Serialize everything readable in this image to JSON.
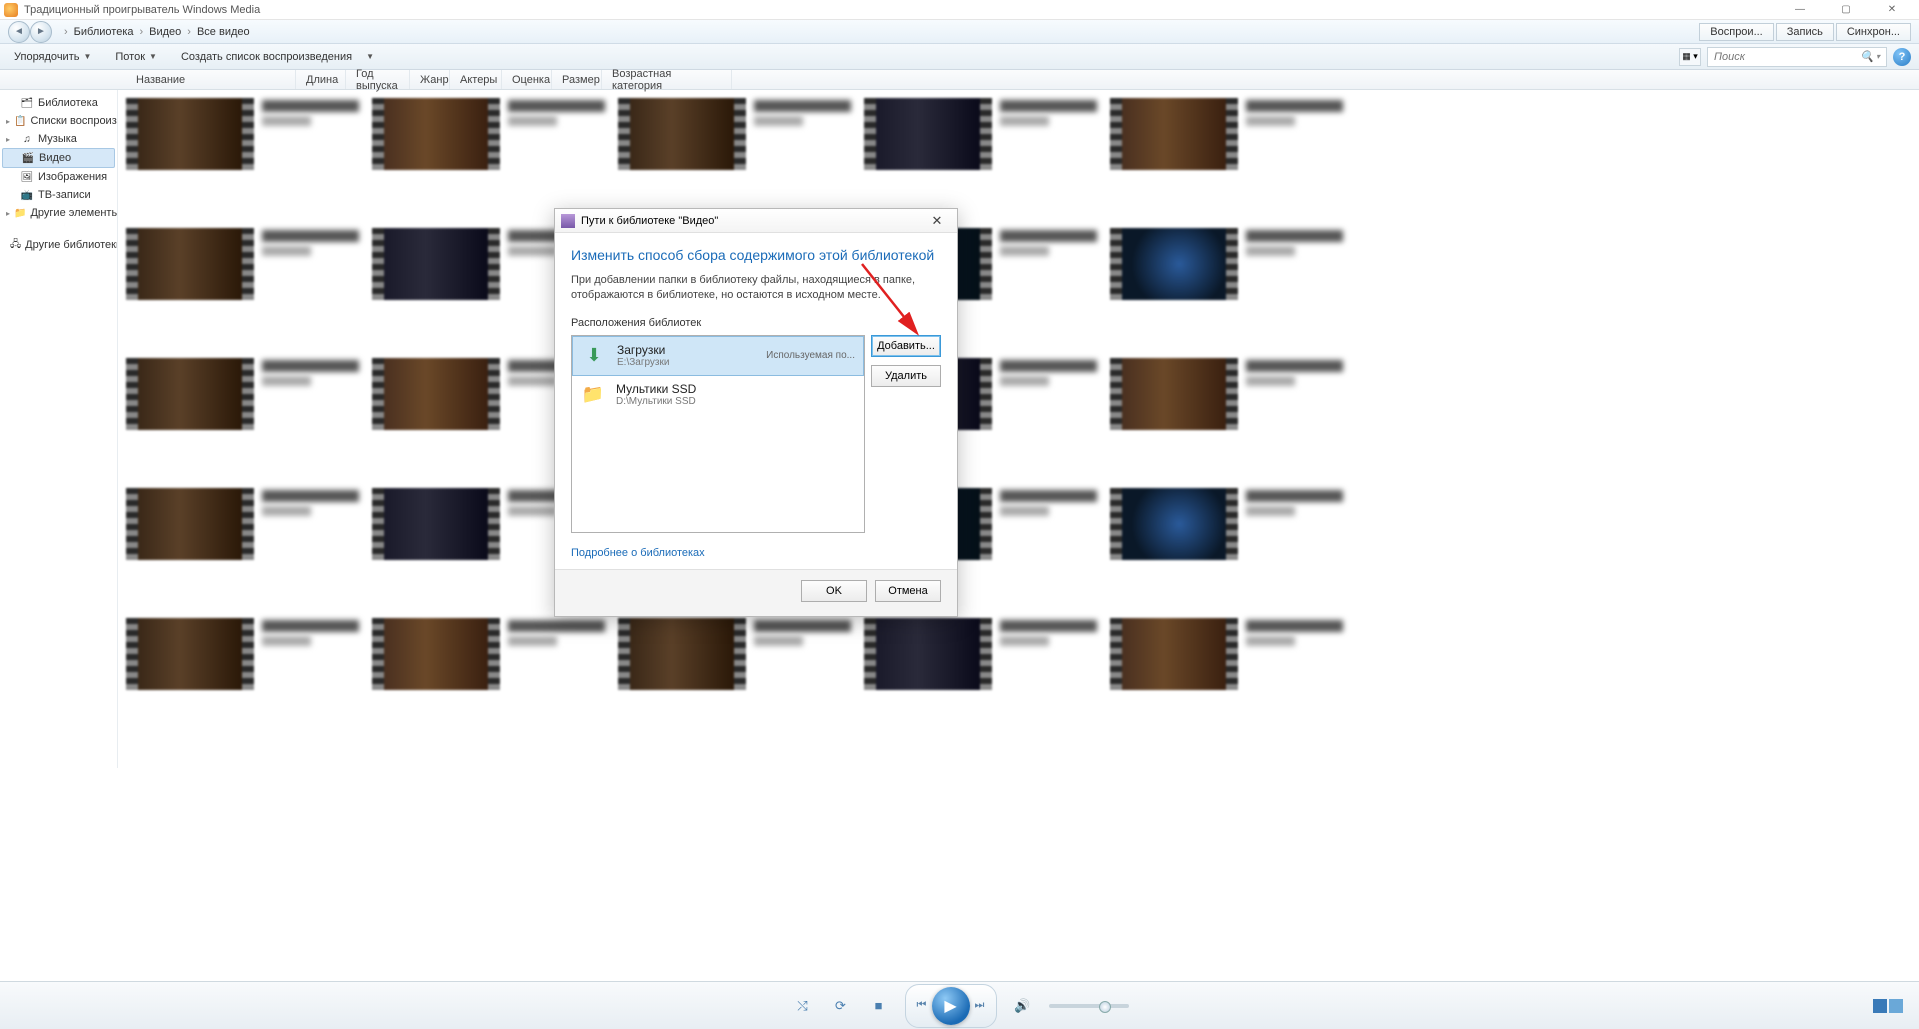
{
  "titlebar": {
    "text": "Традиционный проигрыватель Windows Media"
  },
  "breadcrumb": {
    "library": "Библиотека",
    "section": "Видео",
    "view": "Все видео"
  },
  "tabs": {
    "play_list": "Воспрои...",
    "record": "Запись",
    "sync": "Синхрон..."
  },
  "toolbar": {
    "organize": "Упорядочить",
    "stream": "Поток",
    "create_playlist": "Создать список воспроизведения"
  },
  "search": {
    "placeholder": "Поиск"
  },
  "columns": {
    "name": "Название",
    "length": "Длина",
    "year": "Год выпуска",
    "genre": "Жанр",
    "actors": "Актеры",
    "rating": "Оценка",
    "size": "Размер",
    "age": "Возрастная категория"
  },
  "sidebar": {
    "library": "Библиотека",
    "playlists": "Списки воспроизведе",
    "music": "Музыка",
    "video": "Видео",
    "images": "Изображения",
    "tv": "ТВ-записи",
    "other": "Другие элементы м",
    "other_libs": "Другие библиотеки"
  },
  "dialog": {
    "title": "Пути к библиотеке \"Видео\"",
    "heading": "Изменить способ сбора содержимого этой библиотекой",
    "description": "При добавлении папки в библиотеку файлы, находящиеся в папке, отображаются в библиотеке, но остаются в исходном месте.",
    "locations_label": "Расположения библиотек",
    "add": "Добавить...",
    "remove": "Удалить",
    "learn_more": "Подробнее о библиотеках",
    "ok": "OK",
    "cancel": "Отмена",
    "loc1": {
      "name": "Загрузки",
      "path": "E:\\Загрузки",
      "default": "Используемая по..."
    },
    "loc2": {
      "name": "Мультики SSD",
      "path": "D:\\Мультики SSD"
    }
  }
}
